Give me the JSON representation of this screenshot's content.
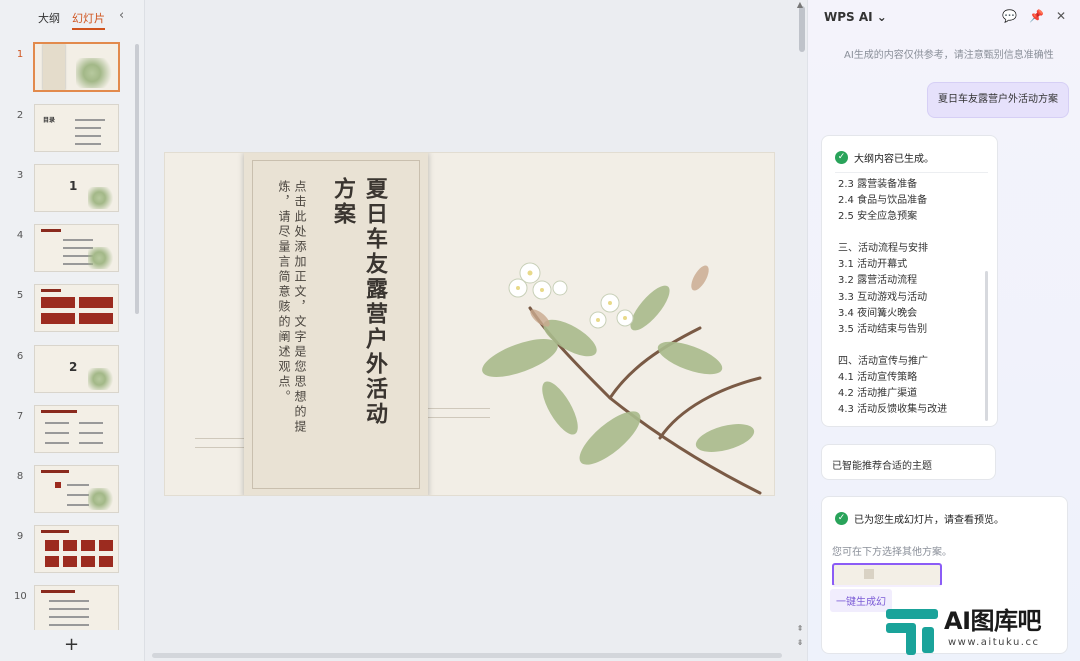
{
  "left_panel": {
    "tabs": [
      {
        "label": "大纲",
        "active": false
      },
      {
        "label": "幻灯片",
        "active": true
      }
    ],
    "collapse_icon": "chevron-left-icon",
    "slides": [
      "1",
      "2",
      "3",
      "4",
      "5",
      "6",
      "7",
      "8",
      "9",
      "10"
    ],
    "thumb_texts": {
      "s2": "目录",
      "s3": "1",
      "s6": "2"
    },
    "add_label": "+"
  },
  "slide": {
    "title_line1": "夏日车友露营户外活动",
    "title_line2": "方案",
    "body": "点击此处添加正文，文字是您思想的提炼，请尽量言简意赅的阐述观点。"
  },
  "ai_panel": {
    "title": "WPS AI",
    "title_caret": "⌄",
    "icons": [
      "chat-icon",
      "pin-icon",
      "close-icon"
    ],
    "disclaimer": "AI生成的内容仅供参考，请注意甄别信息准确性",
    "user_prompt": "夏日车友露营户外活动方案",
    "outline_card": {
      "header": "大纲内容已生成。",
      "items": [
        "2.3 露营装备准备",
        "2.4 食品与饮品准备",
        "2.5 安全应急预案",
        "",
        "三、活动流程与安排",
        "3.1 活动开幕式",
        "3.2 露营活动流程",
        "3.3 互动游戏与活动",
        "3.4 夜间篝火晚会",
        "3.5 活动结束与告别",
        "",
        "四、活动宣传与推广",
        "4.1 活动宣传策略",
        "4.2 活动推广渠道",
        "4.3 活动反馈收集与改进"
      ]
    },
    "theme_card": {
      "text": "已智能推荐合适的主题"
    },
    "generate_card": {
      "header": "已为您生成幻灯片，请查看预览。",
      "sub": "您可在下方选择其他方案。",
      "button": "一键生成幻"
    }
  },
  "watermark": {
    "title": "AI图库吧",
    "url": "www.aituku.cc"
  },
  "colors": {
    "accent_orange": "#d0541e",
    "ai_purple": "#8b5cf6",
    "success_green": "#29a35a",
    "thumb_red": "#9c2b1f",
    "watermark_teal": "#1aa39a"
  }
}
